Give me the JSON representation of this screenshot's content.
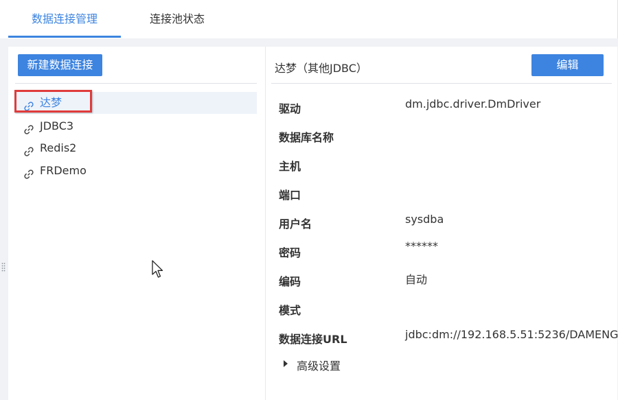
{
  "tabs": [
    {
      "label": "数据连接管理",
      "active": true
    },
    {
      "label": "连接池状态",
      "active": false
    }
  ],
  "left": {
    "new_button_label": "新建数据连接",
    "connections": [
      {
        "name": "达梦",
        "selected": true
      },
      {
        "name": "JDBC3",
        "selected": false
      },
      {
        "name": "Redis2",
        "selected": false
      },
      {
        "name": "FRDemo",
        "selected": false
      }
    ]
  },
  "detail": {
    "title": "达梦（其他JDBC）",
    "edit_button_label": "编辑",
    "fields": [
      {
        "label": "驱动",
        "value": "dm.jdbc.driver.DmDriver"
      },
      {
        "label": "数据库名称",
        "value": ""
      },
      {
        "label": "主机",
        "value": ""
      },
      {
        "label": "端口",
        "value": ""
      },
      {
        "label": "用户名",
        "value": "sysdba"
      },
      {
        "label": "密码",
        "value": "******"
      },
      {
        "label": "编码",
        "value": "自动"
      },
      {
        "label": "模式",
        "value": ""
      },
      {
        "label": "数据连接URL",
        "value": "jdbc:dm://192.168.5.51:5236/DAMENG"
      }
    ],
    "advanced_label": "高级设置"
  },
  "colors": {
    "accent": "#3d84e0",
    "highlight_border": "#e03b3b",
    "selected_bg": "#eef3fa"
  },
  "icons": [
    "link-icon",
    "triangle-right-icon",
    "mouse-cursor-icon",
    "drag-handle-icon"
  ]
}
